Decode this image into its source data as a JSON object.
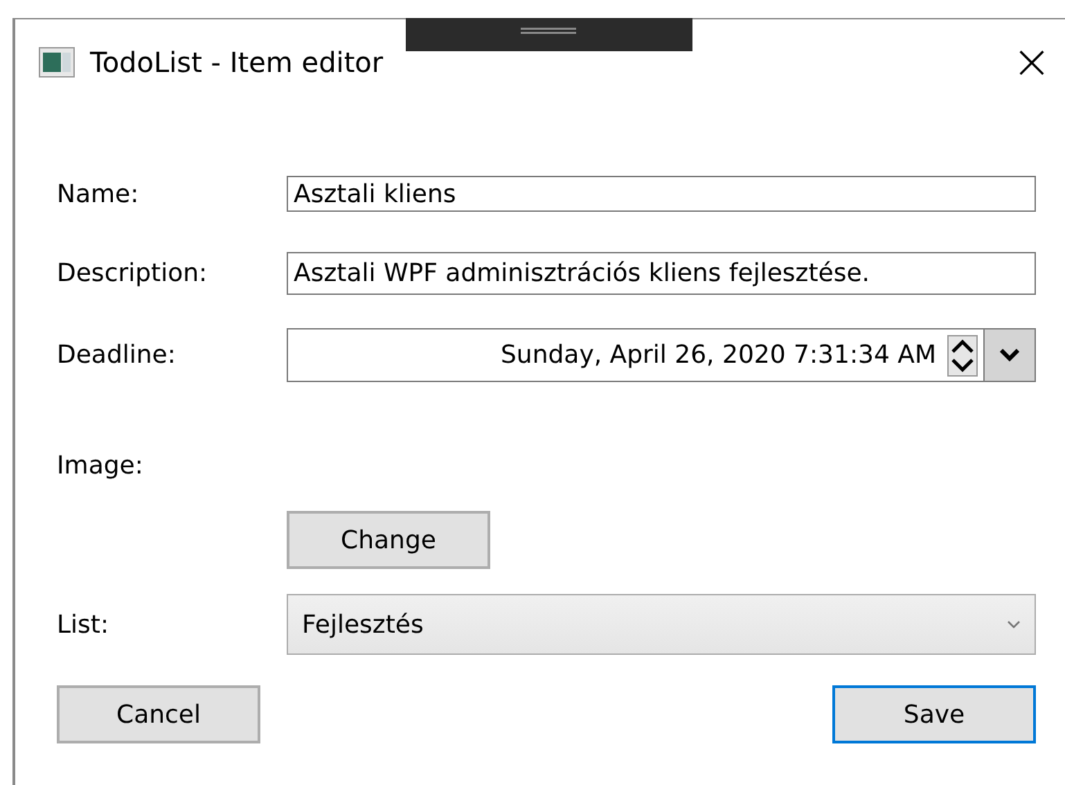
{
  "window": {
    "title": "TodoList - Item editor",
    "close": "×"
  },
  "fields": [
    {
      "kind": "text",
      "label": "Name:",
      "value": "Asztali kliens"
    },
    {
      "kind": "text",
      "label": "Description:",
      "value": "Asztali WPF adminisztrációs kliens fejlesztése."
    },
    {
      "kind": "datetime",
      "label": "Deadline:",
      "value": "Sunday, April 26, 2020 7:31:34 AM"
    },
    {
      "kind": "image",
      "label": "Image:",
      "button": "Change"
    },
    {
      "kind": "combo",
      "label": "List:",
      "value": "Fejlesztés"
    }
  ],
  "buttons": [
    {
      "label": "Cancel",
      "default": false
    },
    {
      "label": "Save",
      "default": true
    }
  ]
}
